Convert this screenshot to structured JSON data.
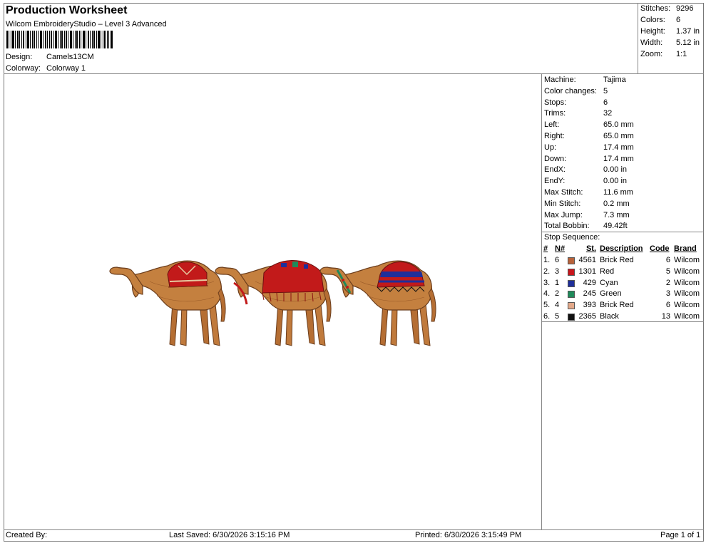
{
  "header": {
    "title": "Production Worksheet",
    "software": "Wilcom EmbroideryStudio – Level 3 Advanced",
    "design_label": "Design:",
    "design_value": "Camels13CM",
    "colorway_label": "Colorway:",
    "colorway_value": "Colorway 1"
  },
  "summary": [
    {
      "label": "Stitches:",
      "value": "9296"
    },
    {
      "label": "Colors:",
      "value": "6"
    },
    {
      "label": "Height:",
      "value": "1.37 in"
    },
    {
      "label": "Width:",
      "value": "5.12 in"
    },
    {
      "label": "Zoom:",
      "value": "1:1"
    }
  ],
  "machine_stats": [
    {
      "label": "Machine:",
      "value": "Tajima"
    },
    {
      "label": "Color changes:",
      "value": "5"
    },
    {
      "label": "Stops:",
      "value": "6"
    },
    {
      "label": "Trims:",
      "value": "32"
    },
    {
      "label": "Left:",
      "value": "65.0 mm"
    },
    {
      "label": "Right:",
      "value": "65.0 mm"
    },
    {
      "label": "Up:",
      "value": "17.4 mm"
    },
    {
      "label": "Down:",
      "value": "17.4 mm"
    },
    {
      "label": "EndX:",
      "value": "0.00 in"
    },
    {
      "label": "EndY:",
      "value": "0.00 in"
    },
    {
      "label": "Max Stitch:",
      "value": "11.6 mm"
    },
    {
      "label": "Min Stitch:",
      "value": "0.2 mm"
    },
    {
      "label": "Max Jump:",
      "value": "7.3 mm"
    },
    {
      "label": "Total Bobbin:",
      "value": "49.42ft"
    }
  ],
  "stop_sequence": {
    "title": "Stop Sequence:",
    "headers": {
      "num": "#",
      "n": "N#",
      "st": "St.",
      "desc": "Description",
      "code": "Code",
      "brand": "Brand"
    },
    "rows": [
      {
        "num": "1.",
        "n": "6",
        "st": "4561",
        "desc": "Brick Red",
        "code": "6",
        "brand": "Wilcom",
        "color": "#b8623a"
      },
      {
        "num": "2.",
        "n": "3",
        "st": "1301",
        "desc": "Red",
        "code": "5",
        "brand": "Wilcom",
        "color": "#c8161d"
      },
      {
        "num": "3.",
        "n": "1",
        "st": "429",
        "desc": "Cyan",
        "code": "2",
        "brand": "Wilcom",
        "color": "#1f2f9a"
      },
      {
        "num": "4.",
        "n": "2",
        "st": "245",
        "desc": "Green",
        "code": "3",
        "brand": "Wilcom",
        "color": "#1f8a5a"
      },
      {
        "num": "5.",
        "n": "4",
        "st": "393",
        "desc": "Brick Red",
        "code": "6",
        "brand": "Wilcom",
        "color": "#e3a98a"
      },
      {
        "num": "6.",
        "n": "5",
        "st": "2365",
        "desc": "Black",
        "code": "13",
        "brand": "Wilcom",
        "color": "#111111"
      }
    ]
  },
  "footer": {
    "created_by": "Created By:",
    "last_saved": "Last Saved: 6/30/2026 3:15:16 PM",
    "printed": "Printed: 6/30/2026 3:15:49 PM",
    "page": "Page 1 of 1"
  },
  "colors": {
    "camel": "#c07a3c",
    "camel_dark": "#7a4a22",
    "saddle_red": "#c21a1a",
    "saddle_blue": "#1f2f9a"
  }
}
